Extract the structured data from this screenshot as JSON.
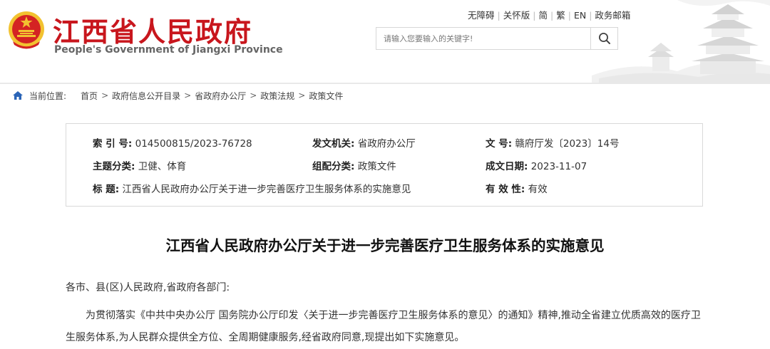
{
  "header": {
    "title": "江西省人民政府",
    "subtitle": "People's Government of Jiangxi Province",
    "top_links": [
      "无障碍",
      "关怀版",
      "简",
      "繁",
      "EN",
      "政务邮箱"
    ],
    "search_placeholder": "请输入您要输入的关键字!"
  },
  "breadcrumb": {
    "label": "当前位置:",
    "items": [
      "首页",
      "政府信息公开目录",
      "省政府办公厅",
      "政策法规",
      "政策文件"
    ]
  },
  "meta": {
    "index_label": "索 引 号:",
    "index_value": "014500815/2023-76728",
    "issuer_label": "发文机关:",
    "issuer_value": "省政府办公厅",
    "docno_label": "文 号:",
    "docno_value": "赣府厅发〔2023〕14号",
    "topic_label": "主题分类:",
    "topic_value": "卫健、体育",
    "org_label": "组配分类:",
    "org_value": "政策文件",
    "date_label": "成文日期:",
    "date_value": "2023-11-07",
    "title_label": "标 题:",
    "title_value": "江西省人民政府办公厅关于进一步完善医疗卫生服务体系的实施意见",
    "validity_label": "有 效 性:",
    "validity_value": "有效"
  },
  "article": {
    "title": "江西省人民政府办公厅关于进一步完善医疗卫生服务体系的实施意见",
    "salutation": "各市、县(区)人民政府,省政府各部门:",
    "paragraph1": "为贯彻落实《中共中央办公厅 国务院办公厅印发〈关于进一步完善医疗卫生服务体系的意见〉的通知》精神,推动全省建立优质高效的医疗卫生服务体系,为人民群众提供全方位、全周期健康服务,经省政府同意,现提出如下实施意见。"
  },
  "colors": {
    "brand_red": "#c8161d",
    "emblem_gold": "#f2c230",
    "border_gray": "#d9d9d9"
  },
  "icons": [
    "national-emblem-icon",
    "search-icon",
    "home-icon"
  ]
}
